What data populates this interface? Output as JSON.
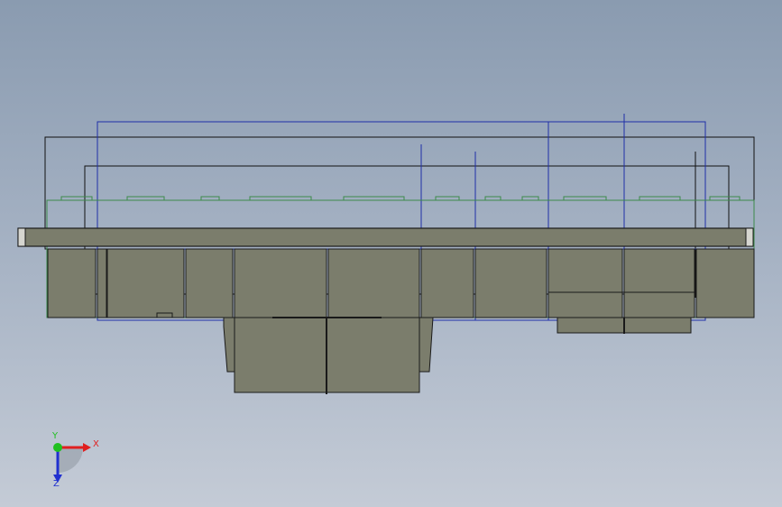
{
  "viewport": {
    "background_top": "#8a9bb0",
    "background_bottom": "#c4cbd6",
    "part_fill": "#7b7d6c",
    "part_stroke": "#1a1a1a",
    "sketch_color_blue": "#1f2fa8",
    "sketch_color_green": "#3c8a4a",
    "sketch_color_black": "#111111"
  },
  "triad": {
    "x_label": "X",
    "y_label": "Y",
    "z_label": "Z",
    "x_color": "#e02020",
    "y_color": "#20c020",
    "z_color": "#2030d0"
  }
}
